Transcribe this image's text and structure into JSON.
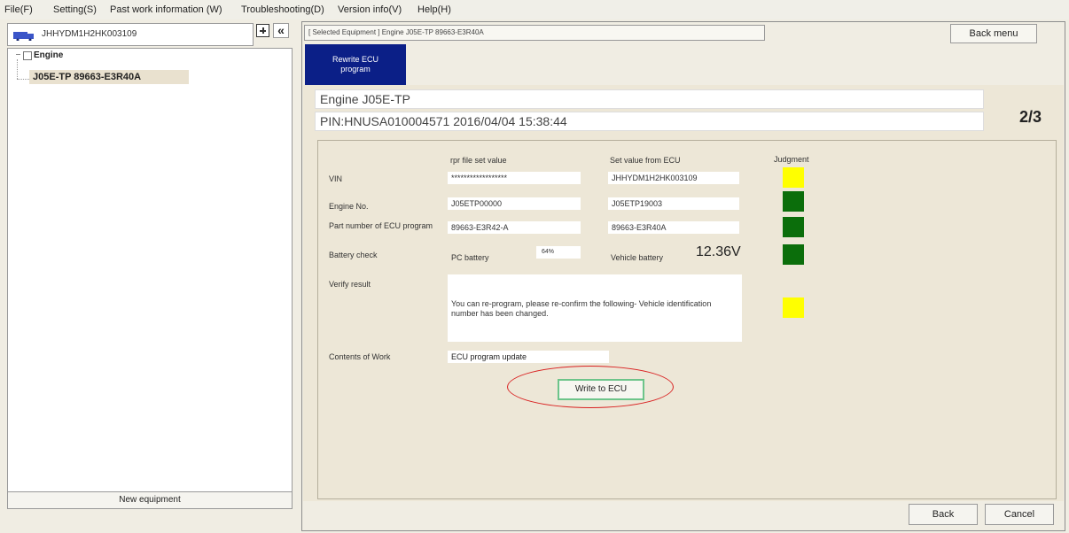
{
  "menu": [
    {
      "label": "File(F)"
    },
    {
      "label": "Setting(S)"
    },
    {
      "label": "Past work information (W)"
    },
    {
      "label": "Troubleshooting(D)"
    },
    {
      "label": "Version info(V)"
    },
    {
      "label": "Help(H)"
    }
  ],
  "left_panel": {
    "vehicle_id": "JHHYDM1H2HK003109",
    "tree_root": "Engine",
    "tree_child": "J05E-TP 89663-E3R40A",
    "new_equipment_button": "New equipment"
  },
  "header": {
    "selected_equipment": "[ Selected Equipment ] Engine J05E-TP 89663-E3R40A",
    "back_menu_button": "Back menu",
    "tab_label": "Rewrite ECU program"
  },
  "info": {
    "engine_line": "Engine J05E-TP",
    "pin_line": "PIN:HNUSA010004571 2016/04/04 15:38:44",
    "page_indicator": "2/3"
  },
  "table": {
    "col_rpr": "rpr file set value",
    "col_ecu": "Set value from ECU",
    "col_judgment": "Judgment",
    "rows": [
      {
        "label": "VIN",
        "rpr": "******************",
        "ecu": "JHHYDM1H2HK003109",
        "judgment": "#ffff00"
      },
      {
        "label": "Engine No.",
        "rpr": "J05ETP00000",
        "ecu": "J05ETP19003",
        "judgment": "#0b6e0b"
      },
      {
        "label": "Part number of ECU program",
        "rpr": "89663-E3R42-A",
        "ecu": "89663-E3R40A",
        "judgment": "#0b6e0b"
      }
    ]
  },
  "battery": {
    "label": "Battery check",
    "pc_label": "PC battery",
    "pc_value": "64%",
    "vehicle_label": "Vehicle battery",
    "vehicle_value": "12.36V",
    "judgment": "#0b6e0b"
  },
  "verify": {
    "label": "Verify result",
    "text": "You can re-program, please re-confirm the following- Vehicle identification number has been changed.",
    "judgment": "#ffff00"
  },
  "work": {
    "label": "Contents of Work",
    "value": "ECU program update"
  },
  "write_button": "Write to ECU",
  "back_button": "Back",
  "cancel_button": "Cancel",
  "colors": {
    "accent_tab": "#0b1f87",
    "ok_green": "#0b6e0b",
    "warn_yellow": "#ffff00",
    "highlight_ellipse": "#d92020"
  }
}
